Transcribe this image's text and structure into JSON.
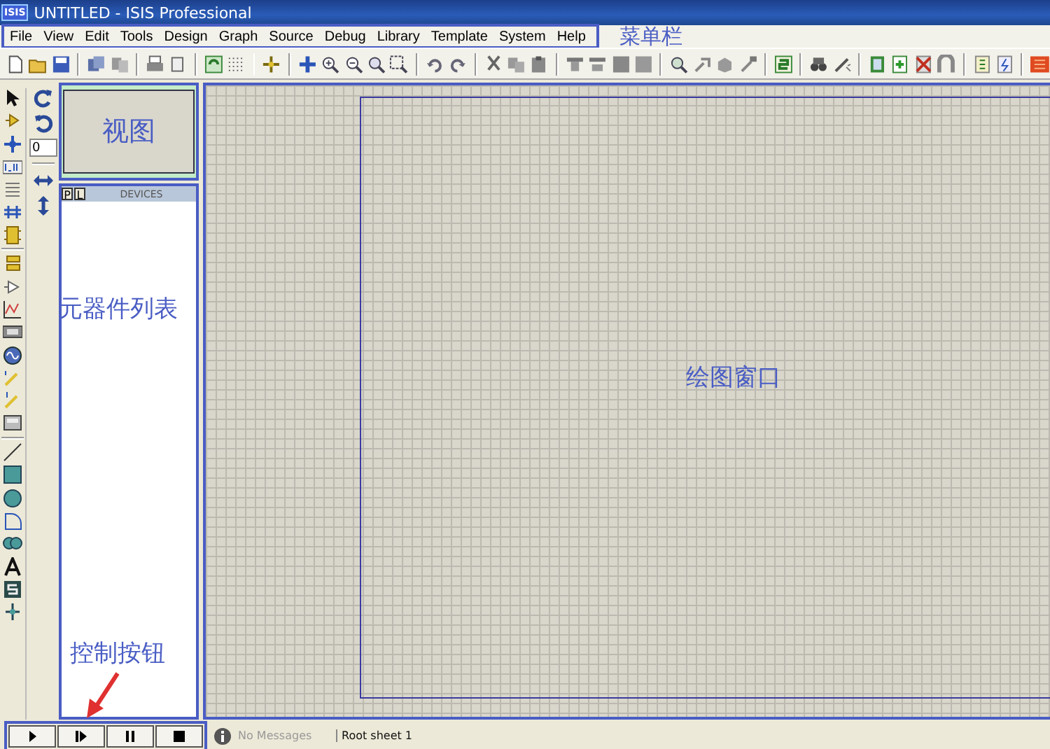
{
  "window": {
    "title": "UNTITLED - ISIS Professional",
    "app_badge": "ISIS"
  },
  "menu": {
    "items": [
      "File",
      "View",
      "Edit",
      "Tools",
      "Design",
      "Graph",
      "Source",
      "Debug",
      "Library",
      "Template",
      "System",
      "Help"
    ],
    "annotation": "菜单栏"
  },
  "rotation_field": {
    "value": "0"
  },
  "overview": {
    "annotation": "视图"
  },
  "devices": {
    "buttons": [
      "P",
      "L"
    ],
    "header": "DEVICES",
    "annotation": "元器件列表"
  },
  "canvas": {
    "annotation": "绘图窗口"
  },
  "controls": {
    "annotation": "控制按钮"
  },
  "status_bar": {
    "message": "No Messages",
    "sheet": "Root sheet 1"
  }
}
